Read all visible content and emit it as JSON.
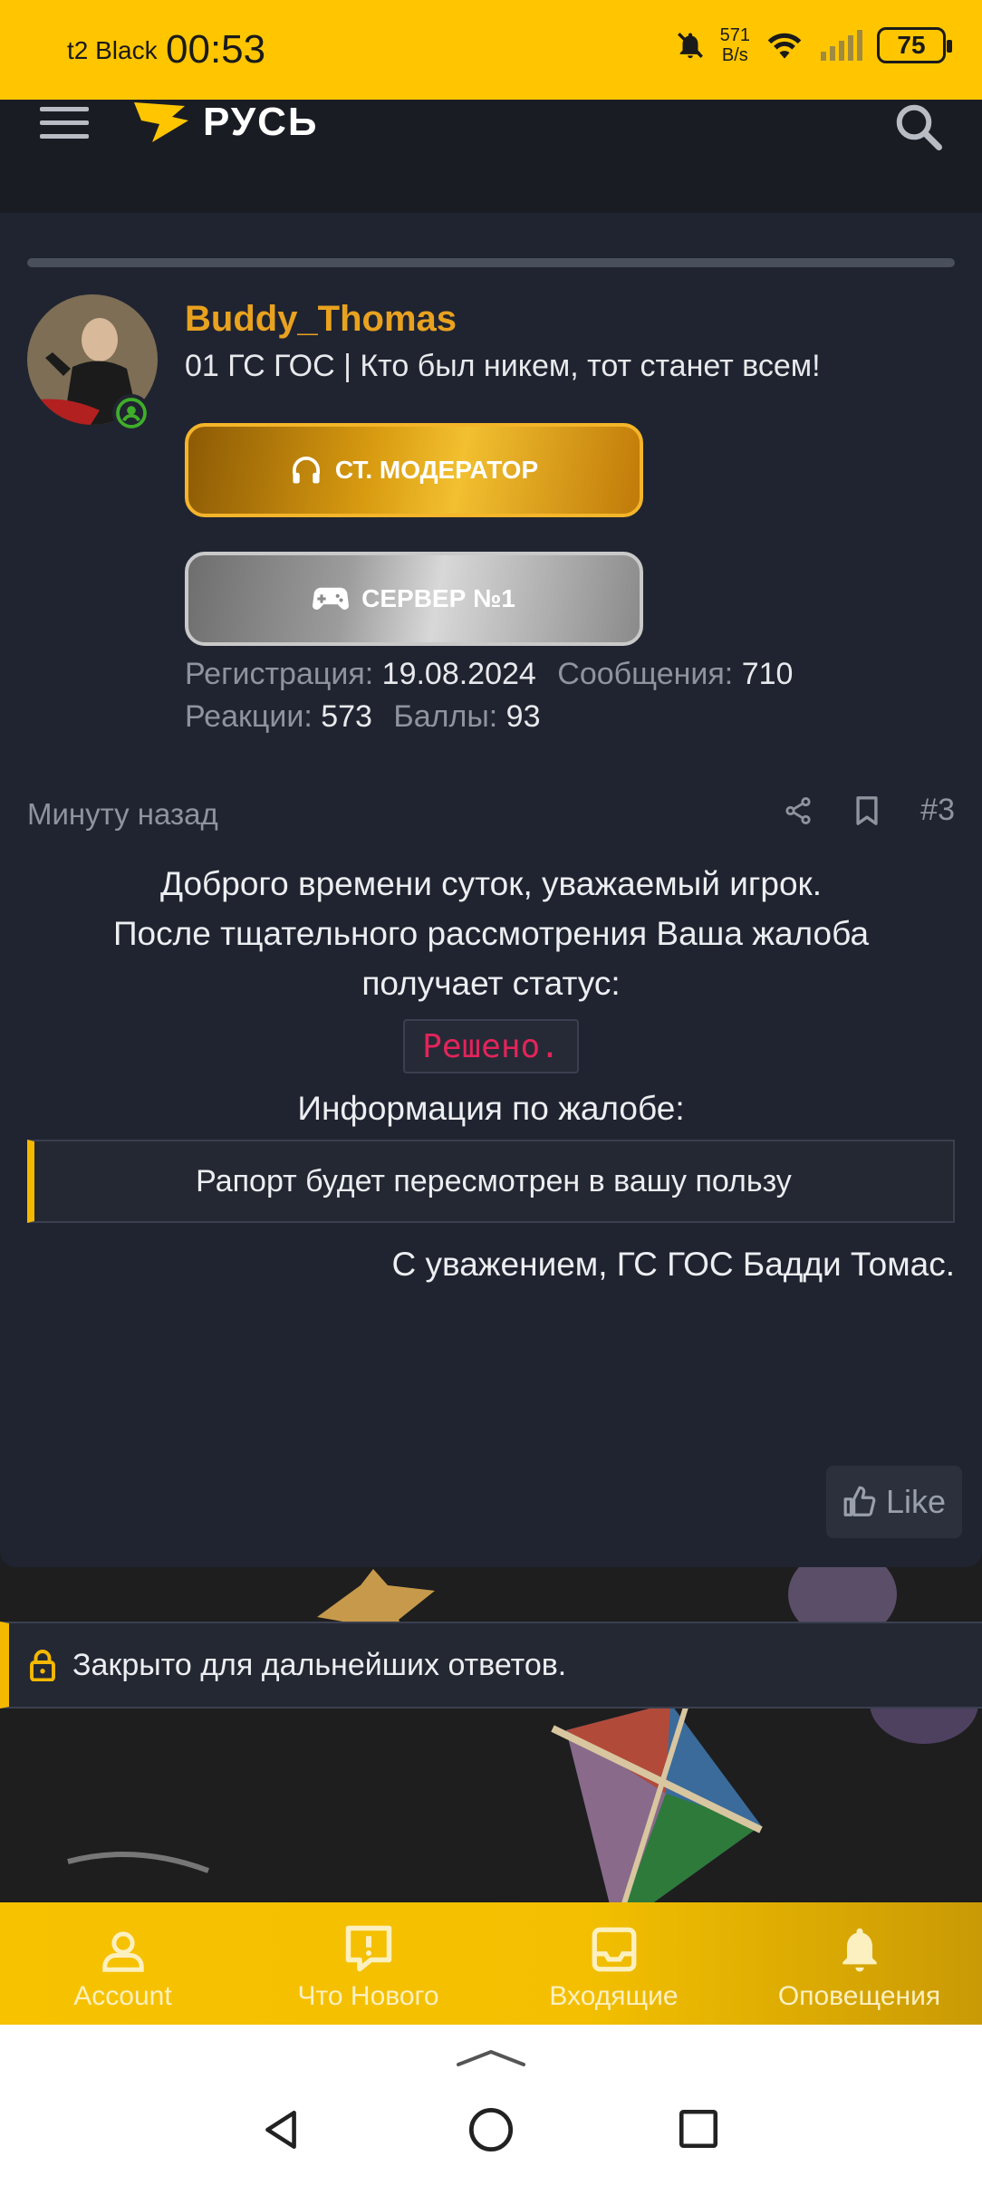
{
  "status_bar": {
    "carrier": "t2 Black",
    "time": "00:53",
    "net_speed_value": "571",
    "net_speed_unit": "B/s",
    "battery": "75"
  },
  "top_nav": {
    "logo_text": "РУСЬ"
  },
  "post": {
    "username": "Buddy_Thomas",
    "user_title": "01 ГС ГОС | Кто был никем, тот станет всем!",
    "badges": [
      {
        "label": "СТ. МОДЕРАТОР",
        "icon": "headphones-icon"
      },
      {
        "label": "СЕРВЕР №1",
        "icon": "gamepad-icon"
      }
    ],
    "stats": {
      "registration_label": "Регистрация:",
      "registration_value": "19.08.2024",
      "messages_label": "Сообщения:",
      "messages_value": "710",
      "reactions_label": "Реакции:",
      "reactions_value": "573",
      "points_label": "Баллы:",
      "points_value": "93"
    },
    "time": "Минуту назад",
    "number": "#3",
    "body": {
      "line1": "Доброго времени суток, уважаемый игрок.",
      "line2": "После тщательного рассмотрения Ваша жалоба",
      "line3": "получает статус:",
      "status": "Решено.",
      "line4": "Информация по жалобе:",
      "quote": "Рапорт будет пересмотрен в вашу пользу",
      "signature": "С уважением, ГС ГОС Бадди Томас."
    },
    "like_label": "Like"
  },
  "locked_notice": "Закрыто для дальнейших ответов.",
  "bottom_nav": {
    "account": "Account",
    "whats_new": "Что Нового",
    "inbox": "Входящие",
    "alerts": "Оповещения"
  },
  "colors": {
    "accent": "#ffc600",
    "username": "#e9a21f",
    "status_text": "#e2245a",
    "card_bg": "#202430"
  }
}
